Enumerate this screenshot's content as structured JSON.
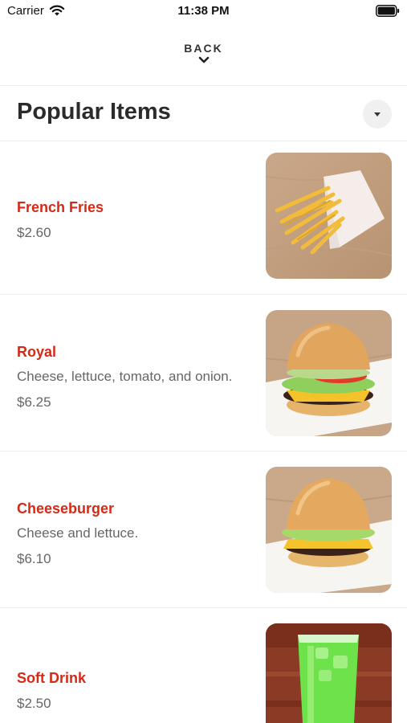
{
  "status_bar": {
    "carrier": "Carrier",
    "time": "11:38 PM"
  },
  "nav": {
    "back_label": "BACK"
  },
  "section": {
    "title": "Popular Items"
  },
  "colors": {
    "accent": "#d42a16",
    "muted_text": "#666666",
    "divider": "#ececec"
  },
  "items": [
    {
      "name": "French Fries",
      "description": "",
      "price": "$2.60",
      "image": "french-fries-image"
    },
    {
      "name": "Royal",
      "description": "Cheese, lettuce, tomato, and onion.",
      "price": "$6.25",
      "image": "royal-burger-image"
    },
    {
      "name": "Cheeseburger",
      "description": "Cheese and lettuce.",
      "price": "$6.10",
      "image": "cheeseburger-image"
    },
    {
      "name": "Soft Drink",
      "description": "",
      "price": "$2.50",
      "image": "soft-drink-image"
    }
  ]
}
